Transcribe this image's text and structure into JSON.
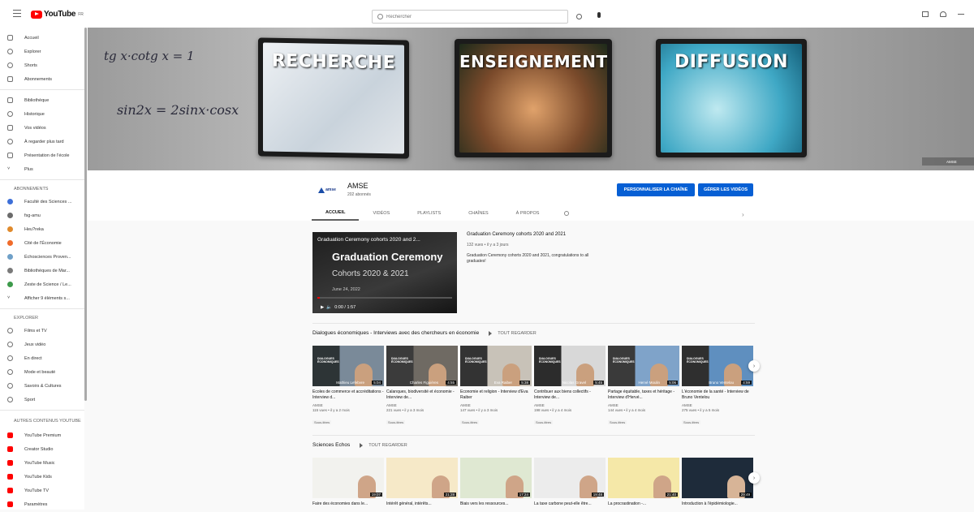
{
  "topbar": {
    "logo_text": "YouTube",
    "logo_sup": "FR",
    "search_placeholder": "Rechercher"
  },
  "sidebar": {
    "main": [
      {
        "label": "Accueil",
        "icon": "home-icon"
      },
      {
        "label": "Explorer",
        "icon": "compass-icon"
      },
      {
        "label": "Shorts",
        "icon": "shorts-icon"
      },
      {
        "label": "Abonnements",
        "icon": "subscriptions-icon"
      }
    ],
    "library": [
      {
        "label": "Bibliothèque",
        "icon": "library-icon"
      },
      {
        "label": "Historique",
        "icon": "history-icon"
      },
      {
        "label": "Vos vidéos",
        "icon": "your-videos-icon"
      },
      {
        "label": "À regarder plus tard",
        "icon": "clock-icon"
      },
      {
        "label": "Présentation de l'école",
        "icon": "playlist-icon"
      },
      {
        "label": "Plus",
        "icon": "chevron-down-icon"
      }
    ],
    "subs_heading": "ABONNEMENTS",
    "subscriptions": [
      {
        "label": "Faculté des Sciences ...",
        "color": "#3d6fd8"
      },
      {
        "label": "fsg-amu",
        "color": "#6b6b6b"
      },
      {
        "label": "Heu?reka",
        "color": "#e08a2c"
      },
      {
        "label": "Cité de l'Économie",
        "color": "#f06b2a"
      },
      {
        "label": "Échosciences Proven...",
        "color": "#6fa0c8"
      },
      {
        "label": "Bibliothèques de Mar...",
        "color": "#7a7a7a"
      },
      {
        "label": "Zeste de Science / Le...",
        "color": "#3d9a4b"
      },
      {
        "label": "Afficher 9 éléments s...",
        "color": ""
      }
    ],
    "explore_heading": "EXPLORER",
    "explore": [
      {
        "label": "Films et TV",
        "icon": "film-icon"
      },
      {
        "label": "Jeux vidéo",
        "icon": "gamepad-icon"
      },
      {
        "label": "En direct",
        "icon": "live-icon"
      },
      {
        "label": "Mode et beauté",
        "icon": "hanger-icon"
      },
      {
        "label": "Savoirs & Cultures",
        "icon": "bulb-icon"
      },
      {
        "label": "Sport",
        "icon": "trophy-icon"
      }
    ],
    "more_heading": "AUTRES CONTENUS YOUTUBE",
    "more": [
      {
        "label": "YouTube Premium"
      },
      {
        "label": "Creator Studio"
      },
      {
        "label": "YouTube Music"
      },
      {
        "label": "YouTube Kids"
      },
      {
        "label": "YouTube TV"
      },
      {
        "label": "Paramètres"
      }
    ]
  },
  "banner": {
    "panel1": "RECHERCHE",
    "panel2": "ENSEIGNEMENT",
    "panel3": "DIFFUSION",
    "math1": "sin2x = 2sinx·cosx",
    "math2": "tg x·cotg x = 1",
    "watermark": "AMSE"
  },
  "channel": {
    "avatar_text": "amse",
    "name": "AMSE",
    "subscribers": "202 abonnés",
    "customize_btn": "PERSONNALISER LA CHAÎNE",
    "manage_btn": "GÉRER LES VIDÉOS",
    "tabs": [
      "ACCUEIL",
      "VIDÉOS",
      "PLAYLISTS",
      "CHAÎNES",
      "À PROPOS"
    ]
  },
  "featured": {
    "overlay_title": "Graduation Ceremony cohorts 2020 and 2...",
    "big": "Graduation Ceremony",
    "sub": "Cohorts 2020 & 2021",
    "date": "June 24, 2022",
    "time": "0:00 / 1:57",
    "title": "Graduation Ceremony cohorts 2020 and 2021",
    "meta": "132 vues • il y a 3 jours",
    "desc": "Graduation Ceremony cohorts 2020 and 2021, congratulations to all graduates!"
  },
  "shelf1": {
    "title": "Dialogues économiques - Interviews avec des chercheurs en économie",
    "play_all": "TOUT REGARDER",
    "cards": [
      {
        "name": "Mathieu Lefebvre",
        "dur": "5:04",
        "title": "Écoles de commerce et accréditations - Interview d...",
        "channel": "AMSE",
        "meta": "115 vues • il y a 2 mois",
        "tag": "Sous-titres"
      },
      {
        "name": "Charles Figuières",
        "dur": "4:55",
        "title": "Calanques, biodiversité et économie - Interview de...",
        "channel": "AMSE",
        "meta": "221 vues • il y a 3 mois",
        "tag": "Sous-titres"
      },
      {
        "name": "Eva Raiber",
        "dur": "5:38",
        "title": "Économie et religion - Interview d'Eva Raiber",
        "channel": "AMSE",
        "meta": "147 vues • il y a 3 mois",
        "tag": "Sous-titres"
      },
      {
        "name": "Nicolas Gravel",
        "dur": "5:45",
        "title": "Contribuer aux biens collectifs - Interview de...",
        "channel": "AMSE",
        "meta": "198 vues • il y a 4 mois",
        "tag": "Sous-titres"
      },
      {
        "name": "Hervé Moulin",
        "dur": "5:06",
        "title": "Partage équitable, taxes et héritage - Interview d'Hervé...",
        "channel": "AMSE",
        "meta": "144 vues • il y a 4 mois",
        "tag": "Sous-titres"
      },
      {
        "name": "Bruno Ventelou",
        "dur": "4:59",
        "title": "L'économie de la santé - Interview de Bruno Ventelou",
        "channel": "AMSE",
        "meta": "275 vues • il y a 5 mois",
        "tag": "Sous-titres"
      }
    ]
  },
  "shelf2": {
    "title": "Sciences Echos",
    "play_all": "TOUT REGARDER",
    "cards": [
      {
        "dur": "19:07",
        "title": "Faire des économies dans le..."
      },
      {
        "dur": "21:28",
        "title": "Intérêt général, intérêts..."
      },
      {
        "dur": "17:24",
        "title": "Biais vers les ressources..."
      },
      {
        "dur": "19:48",
        "title": "La taxe carbone peut-elle être..."
      },
      {
        "dur": "21:40",
        "title": "La procrastination -..."
      },
      {
        "dur": "29:49",
        "title": "Introduction à l'épidémiologie..."
      }
    ]
  }
}
